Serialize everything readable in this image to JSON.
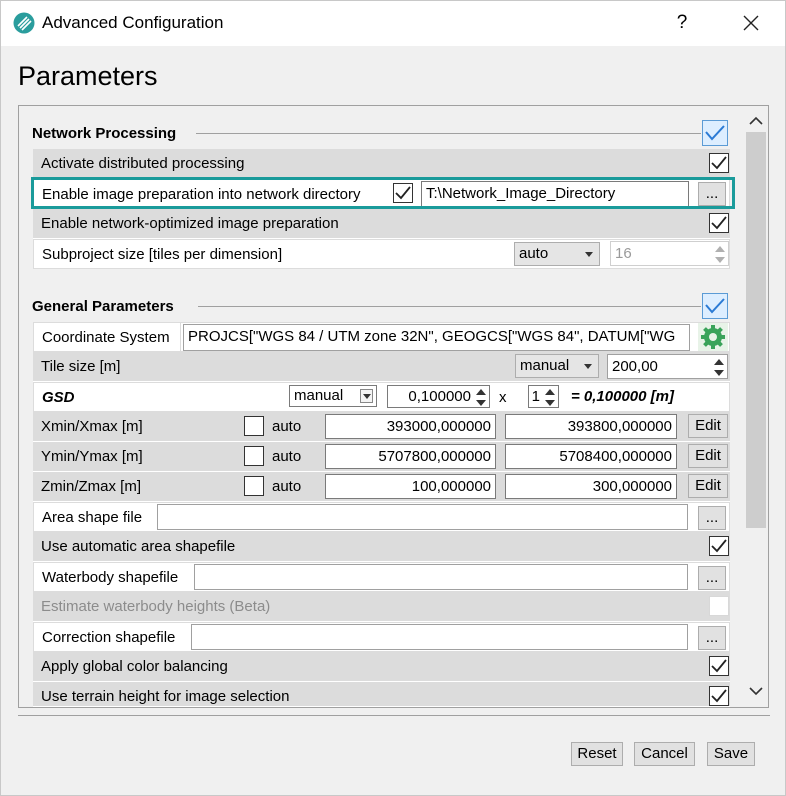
{
  "window": {
    "title": "Advanced Configuration",
    "help_label": "?",
    "heading": "Parameters"
  },
  "colors": {
    "accent": "#1a9b9b",
    "check_blue": "#5b9bd5",
    "row_gray": "#dcdcdc"
  },
  "network": {
    "section_title": "Network Processing",
    "section_checked": true,
    "activate_distributed_label": "Activate distributed processing",
    "activate_distributed_checked": true,
    "image_prep_label": "Enable image preparation into network directory",
    "image_prep_checked": true,
    "image_prep_dir": "T:\\Network_Image_Directory",
    "browse_label": "...",
    "optimized_label": "Enable network-optimized image preparation",
    "optimized_checked": true,
    "subproject_label": "Subproject size [tiles per dimension]",
    "subproject_mode": "auto",
    "subproject_value": "16"
  },
  "general": {
    "section_title": "General Parameters",
    "section_checked": true,
    "coord_label": "Coordinate System",
    "coord_value": "PROJCS[\"WGS 84 / UTM zone 32N\", GEOGCS[\"WGS 84\", DATUM[\"WG",
    "tile_label": "Tile size [m]",
    "tile_mode": "manual",
    "tile_value": "200,00",
    "gsd_label": "GSD",
    "gsd_mode": "manual",
    "gsd_value": "0,100000",
    "gsd_times": "x",
    "gsd_factor": "1",
    "gsd_result": "= 0,100000 [m]",
    "xminmax_label": "Xmin/Xmax [m]",
    "xmin": "393000,000000",
    "xmax": "393800,000000",
    "yminmax_label": "Ymin/Ymax [m]",
    "ymin": "5707800,000000",
    "ymax": "5708400,000000",
    "zminmax_label": "Zmin/Zmax [m]",
    "zmin": "100,000000",
    "zmax": "300,000000",
    "auto_label": "auto",
    "edit_label": "Edit",
    "area_shape_label": "Area shape file",
    "area_shape_value": "",
    "auto_area_label": "Use automatic area shapefile",
    "auto_area_checked": true,
    "waterbody_label": "Waterbody shapefile",
    "waterbody_value": "",
    "estimate_water_label": "Estimate waterbody heights (Beta)",
    "estimate_water_checked": false,
    "correction_label": "Correction shapefile",
    "correction_value": "",
    "color_balance_label": "Apply global color balancing",
    "color_balance_checked": true,
    "terrain_label": "Use terrain height for image selection",
    "terrain_checked": true,
    "browse_label": "..."
  },
  "footer": {
    "reset_label": "Reset",
    "cancel_label": "Cancel",
    "save_label": "Save"
  }
}
